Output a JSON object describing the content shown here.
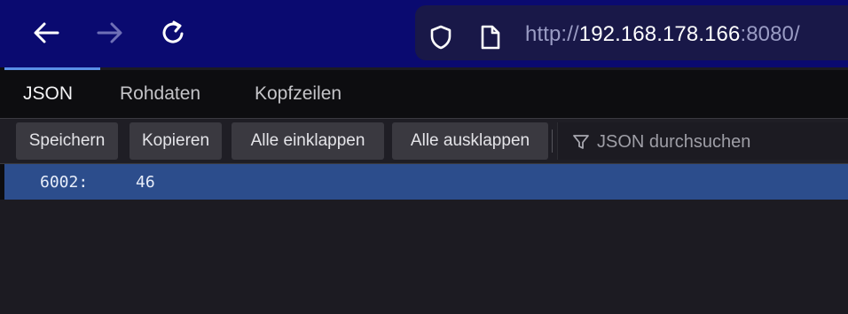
{
  "browser": {
    "back_icon": "arrow-left-icon",
    "forward_icon": "arrow-right-icon",
    "reload_icon": "reload-icon",
    "shield_icon": "shield-icon",
    "page_icon": "page-icon",
    "url": {
      "scheme": "http://",
      "host": "192.168.178.166",
      "port": ":8080/"
    },
    "colors": {
      "toolbar_bg": "#0a0a70",
      "urlbar_bg": "#191848",
      "active_tab_indicator": "#5a8fe6"
    }
  },
  "viewer": {
    "tabs": [
      {
        "label": "JSON",
        "active": true
      },
      {
        "label": "Rohdaten",
        "active": false
      },
      {
        "label": "Kopfzeilen",
        "active": false
      }
    ],
    "toolbar": {
      "save_label": "Speichern",
      "copy_label": "Kopieren",
      "collapse_all_label": "Alle einklappen",
      "expand_all_label": "Alle ausklappen",
      "filter_icon": "filter-icon",
      "filter_placeholder": "JSON durchsuchen"
    },
    "rows": [
      {
        "key": "6002:",
        "value": "46",
        "selected": true
      }
    ],
    "colors": {
      "selected_row_bg": "#2c4d8c",
      "content_bg": "#1c1b22"
    }
  }
}
